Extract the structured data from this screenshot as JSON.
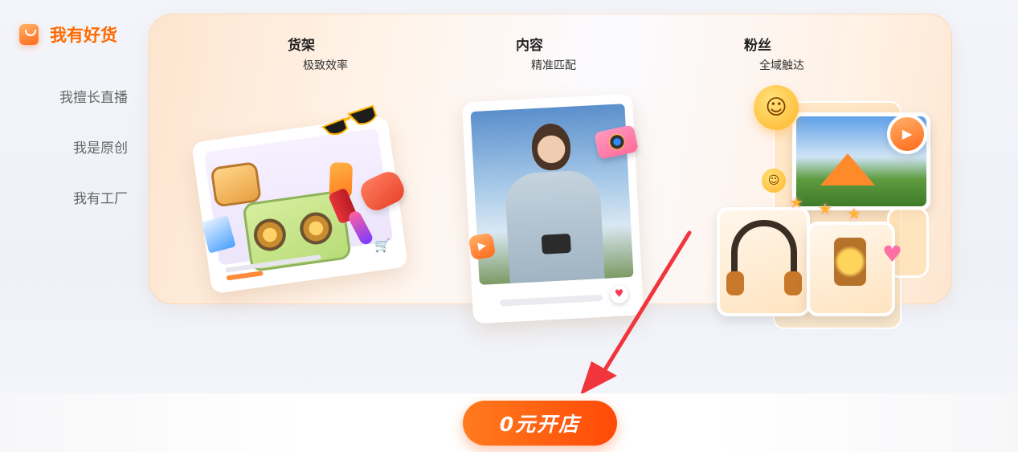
{
  "sidebar": {
    "active_label": "我有好货",
    "items": [
      {
        "label": "我擅长直播"
      },
      {
        "label": "我是原创"
      },
      {
        "label": "我有工厂"
      }
    ]
  },
  "features": [
    {
      "title": "货架",
      "subtitle": "极致效率"
    },
    {
      "title": "内容",
      "subtitle": "精准匹配"
    },
    {
      "title": "粉丝",
      "subtitle": "全域触达"
    }
  ],
  "icons": {
    "bag": "shopping-bag-icon",
    "cart": "cart-icon",
    "heart": "heart-icon",
    "play": "play-icon",
    "arrow": "arrow-annotation"
  },
  "colors": {
    "accent": "#ff6a00",
    "button_start": "#ff7b1e",
    "button_end": "#ff4a06",
    "arrow": "#f0353d"
  },
  "cta": {
    "label": "0元开店"
  }
}
